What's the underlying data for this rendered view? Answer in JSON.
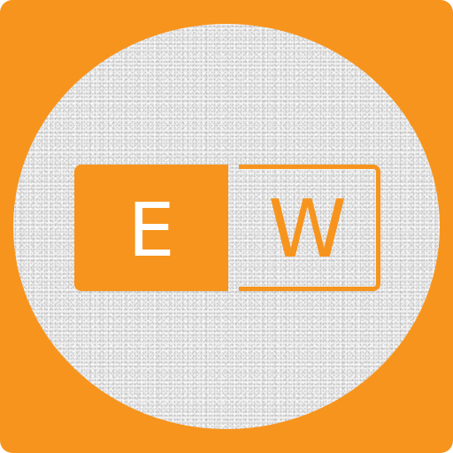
{
  "logo": {
    "letter_left": "E",
    "letter_right": "W"
  },
  "colors": {
    "brand_orange": "#f7941d",
    "badge_background": "#efefef",
    "letter_on_orange": "#ffffff"
  }
}
